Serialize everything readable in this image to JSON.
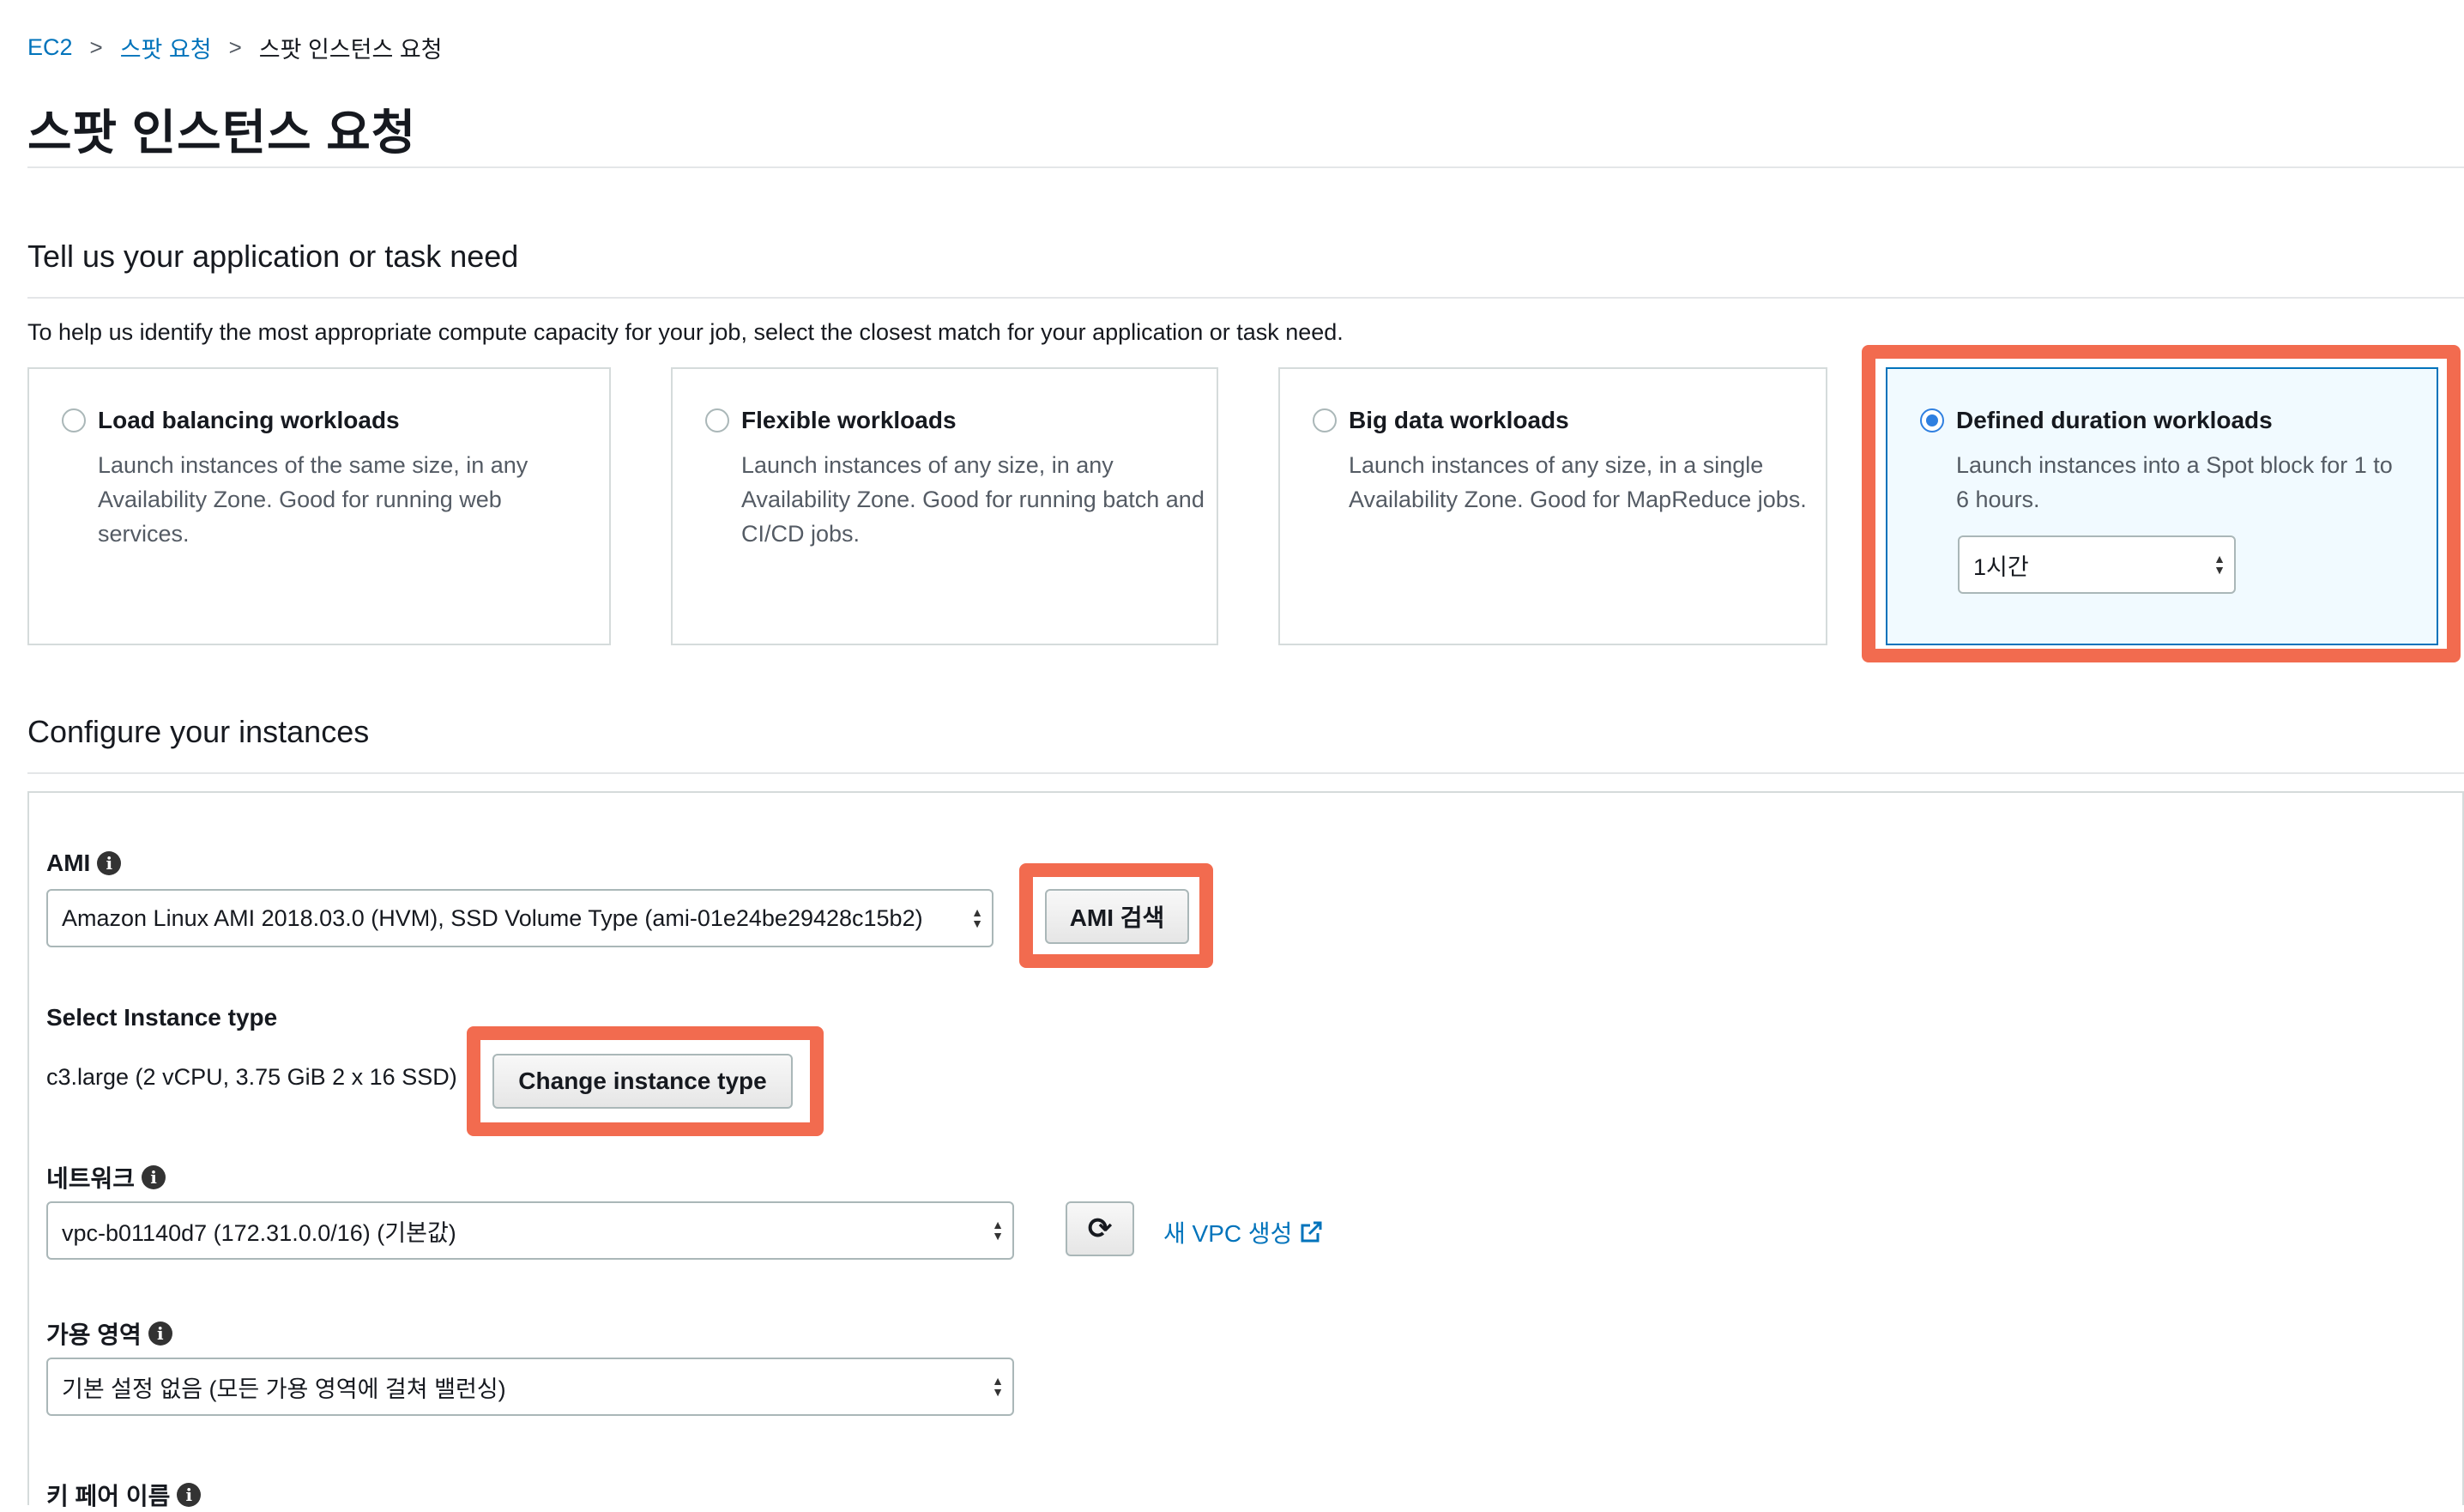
{
  "breadcrumb": {
    "items": [
      "EC2",
      "스팟 요청",
      "스팟 인스턴스 요청"
    ],
    "separator": ">"
  },
  "page_title": "스팟 인스턴스 요청",
  "need_section": {
    "title": "Tell us your application or task need",
    "help": "To help us identify the most appropriate compute capacity for your job, select the closest match for your application or task need.",
    "cards": [
      {
        "title": "Load balancing workloads",
        "desc": "Launch instances of the same size, in any Availability Zone. Good for running web services.",
        "selected": false
      },
      {
        "title": "Flexible workloads",
        "desc": "Launch instances of any size, in any Availability Zone. Good for running batch and CI/CD jobs.",
        "selected": false
      },
      {
        "title": "Big data workloads",
        "desc": "Launch instances of any size, in a single Availability Zone. Good for MapReduce jobs.",
        "selected": false
      },
      {
        "title": "Defined duration workloads",
        "desc": "Launch instances into a Spot block for 1 to 6 hours.",
        "selected": true,
        "duration_value": "1시간"
      }
    ]
  },
  "config_section": {
    "title": "Configure your instances",
    "ami": {
      "label": "AMI",
      "value": "Amazon Linux AMI 2018.03.0 (HVM), SSD Volume Type (ami-01e24be29428c15b2)",
      "search_button": "AMI 검색"
    },
    "instance_type": {
      "label": "Select Instance type",
      "value": "c3.large (2 vCPU, 3.75 GiB 2 x 16 SSD)",
      "change_button": "Change instance type"
    },
    "network": {
      "label": "네트워크",
      "value": "vpc-b01140d7 (172.31.0.0/16) (기본값)",
      "new_vpc_link": "새 VPC 생성"
    },
    "availability_zone": {
      "label": "가용 영역",
      "value": "기본 설정 없음 (모든 가용 영역에 걸쳐 밸런싱)"
    },
    "key_pair": {
      "label": "키 페어 이름"
    }
  },
  "colors": {
    "link": "#0073bb",
    "highlight": "#f26b4f",
    "radio_selected": "#2f7fe0"
  }
}
